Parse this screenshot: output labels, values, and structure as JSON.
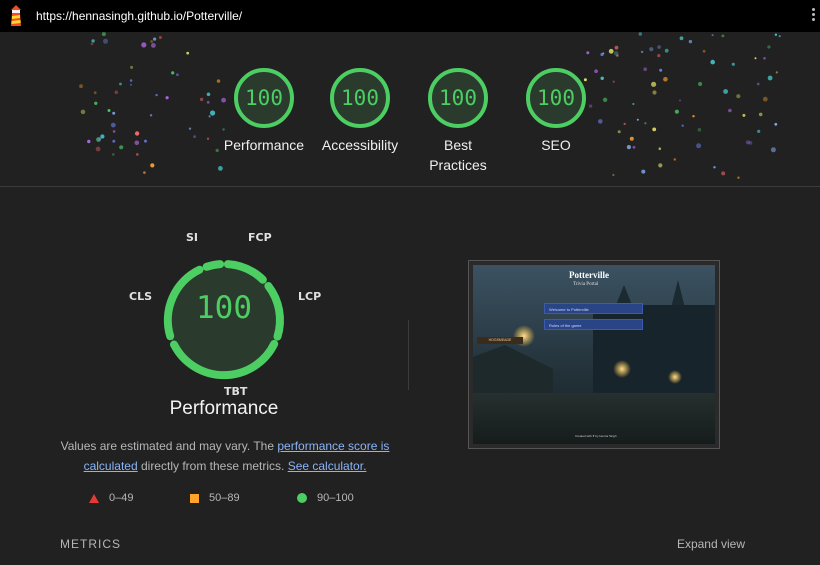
{
  "browser": {
    "url": "https://hennasingh.github.io/Potterville/",
    "logo_icon": "lighthouse-icon",
    "menu_icon": "kebab-menu-icon"
  },
  "categories": [
    {
      "score": "100",
      "label": "Performance"
    },
    {
      "score": "100",
      "label": "Accessibility"
    },
    {
      "score": "100",
      "label": "Best Practices"
    },
    {
      "score": "100",
      "label": "SEO"
    }
  ],
  "performance": {
    "score": "100",
    "title": "Performance",
    "metric_labels": {
      "si": "SI",
      "fcp": "FCP",
      "lcp": "LCP",
      "cls": "CLS",
      "tbt": "TBT"
    },
    "description_prefix": "Values are estimated and may vary. The ",
    "link_score": "performance score is calculated",
    "description_middle": " directly from these metrics. ",
    "link_calculator": "See calculator."
  },
  "legend": [
    {
      "range": "0–49",
      "shape": "triangle",
      "color": "#e53935"
    },
    {
      "range": "50–89",
      "shape": "square",
      "color": "#ffa32a"
    },
    {
      "range": "90–100",
      "shape": "circle",
      "color": "#4cce63"
    }
  ],
  "screenshot": {
    "title": "Potterville",
    "subtitle": "Trivia Portal",
    "buttons": [
      "Welcome to Potterville",
      "Rules of the game"
    ],
    "sign": "HOGSMEADE",
    "footer": "Created with ♥ by Henna Singh"
  },
  "footer": {
    "metrics_label": "METRICS",
    "expand_label": "Expand view"
  },
  "colors": {
    "pass": "#4cce63",
    "background": "#212121",
    "link": "#8ab4f8"
  }
}
